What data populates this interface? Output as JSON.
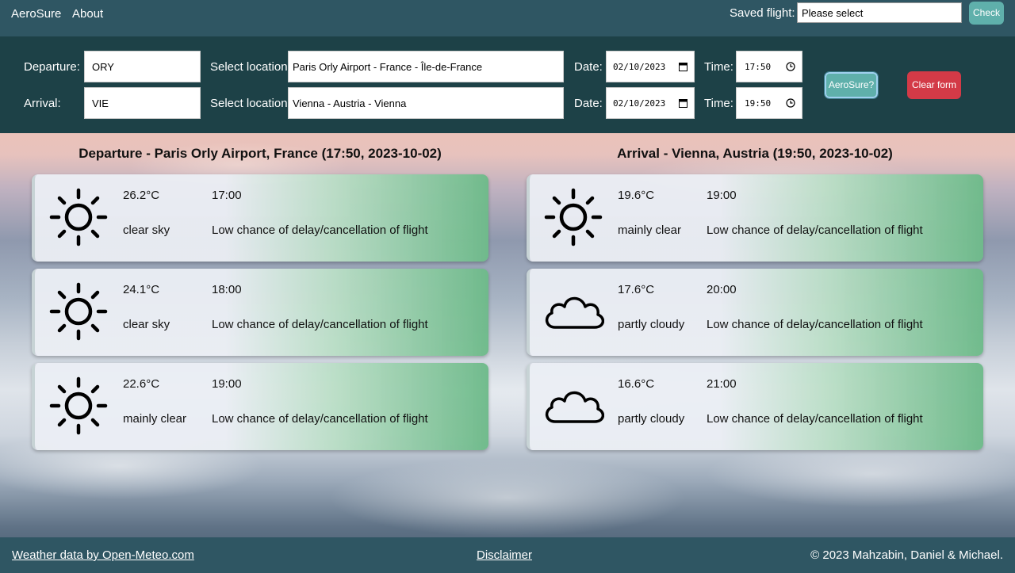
{
  "nav": {
    "brand": "AeroSure",
    "about": "About",
    "saved_flight_label": "Saved flight:",
    "saved_flight_value": "Please select",
    "check_button": "Check"
  },
  "form": {
    "departure_label": "Departure:",
    "departure_code": "ORY",
    "departure_location_label": "Select location:",
    "departure_location": "Paris Orly Airport - France - Île-de-France",
    "departure_date_label": "Date:",
    "departure_date": "02/10/2023",
    "departure_time_label": "Time:",
    "departure_time": "17:50",
    "arrival_label": "Arrival:",
    "arrival_code": "VIE",
    "arrival_location_label": "Select location:",
    "arrival_location": "Vienna - Austria - Vienna",
    "arrival_date_label": "Date:",
    "arrival_date": "02/10/2023",
    "arrival_time_label": "Time:",
    "arrival_time": "19:50",
    "aerosure_button": "AeroSure?",
    "clear_button": "Clear form"
  },
  "departure": {
    "title": "Departure - Paris Orly Airport, France (17:50, 2023-10-02)",
    "cards": [
      {
        "icon": "sun-icon",
        "temp": "26.2°C",
        "time": "17:00",
        "condition": "clear sky",
        "risk": "Low chance of delay/cancellation of flight"
      },
      {
        "icon": "sun-icon",
        "temp": "24.1°C",
        "time": "18:00",
        "condition": "clear sky",
        "risk": "Low chance of delay/cancellation of flight"
      },
      {
        "icon": "sun-icon",
        "temp": "22.6°C",
        "time": "19:00",
        "condition": "mainly clear",
        "risk": "Low chance of delay/cancellation of flight"
      }
    ]
  },
  "arrival": {
    "title": "Arrival - Vienna, Austria (19:50, 2023-10-02)",
    "cards": [
      {
        "icon": "sun-icon",
        "temp": "19.6°C",
        "time": "19:00",
        "condition": "mainly clear",
        "risk": "Low chance of delay/cancellation of flight"
      },
      {
        "icon": "cloud-icon",
        "temp": "17.6°C",
        "time": "20:00",
        "condition": "partly cloudy",
        "risk": "Low chance of delay/cancellation of flight"
      },
      {
        "icon": "cloud-icon",
        "temp": "16.6°C",
        "time": "21:00",
        "condition": "partly cloudy",
        "risk": "Low chance of delay/cancellation of flight"
      }
    ]
  },
  "footer": {
    "weather_link": "Weather data by Open-Meteo.com",
    "disclaimer_link": "Disclaimer",
    "copyright": "© 2023 Mahzabin, Daniel & Michael."
  }
}
